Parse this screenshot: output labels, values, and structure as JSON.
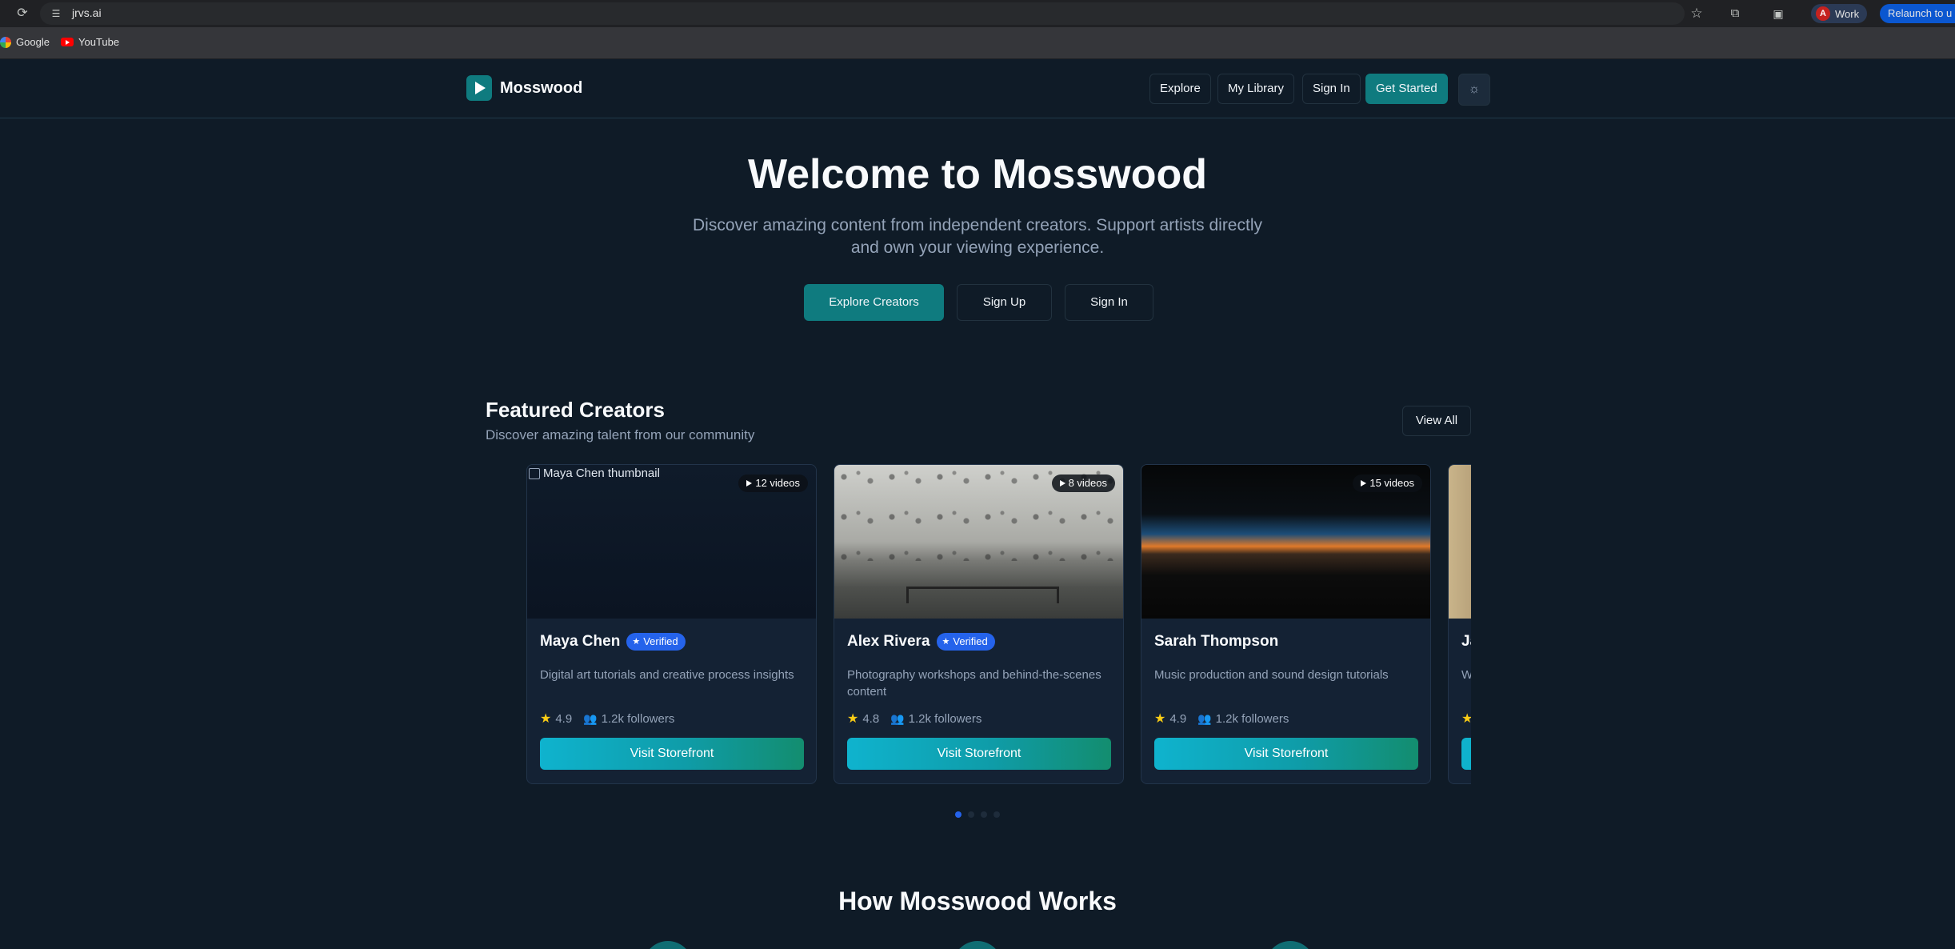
{
  "browser": {
    "url": "jrvs.ai",
    "profile_label": "Work",
    "profile_initial": "A",
    "relaunch_label": "Relaunch to u",
    "bookmarks": [
      {
        "label": "Google",
        "icon": "google-icon"
      },
      {
        "label": "YouTube",
        "icon": "youtube-icon"
      }
    ]
  },
  "header": {
    "brand": "Mosswood",
    "nav": {
      "explore": "Explore",
      "my_library": "My Library",
      "sign_in": "Sign In",
      "get_started": "Get Started"
    },
    "theme_icon": "sun-icon"
  },
  "hero": {
    "title": "Welcome to Mosswood",
    "subtitle": "Discover amazing content from independent creators. Support artists directly and own your viewing experience.",
    "buttons": {
      "explore_creators": "Explore Creators",
      "sign_up": "Sign Up",
      "sign_in": "Sign In"
    }
  },
  "featured": {
    "title": "Featured Creators",
    "subtitle": "Discover amazing talent from our community",
    "view_all": "View All",
    "cards": [
      {
        "name": "Maya Chen",
        "verified_label": "Verified",
        "thumb_alt": "Maya Chen thumbnail",
        "video_count": "12 videos",
        "description": "Digital art tutorials and creative process insights",
        "rating": "4.9",
        "followers": "1.2k followers",
        "cta": "Visit Storefront"
      },
      {
        "name": "Alex Rivera",
        "verified_label": "Verified",
        "video_count": "8 videos",
        "description": "Photography workshops and behind-the-scenes content",
        "rating": "4.8",
        "followers": "1.2k followers",
        "cta": "Visit Storefront"
      },
      {
        "name": "Sarah Thompson",
        "video_count": "15 videos",
        "description": "Music production and sound design tutorials",
        "rating": "4.9",
        "followers": "1.2k followers",
        "cta": "Visit Storefront"
      },
      {
        "name_partial": "Ja",
        "description_partial": "W"
      }
    ],
    "carousel_pages": 4,
    "active_page": 1
  },
  "how_it_works": {
    "title": "How Mosswood Works"
  },
  "colors": {
    "page_bg": "#0f1b27",
    "brand_teal": "#0f7b7f",
    "verified_blue": "#2563eb",
    "star_yellow": "#facc15"
  }
}
